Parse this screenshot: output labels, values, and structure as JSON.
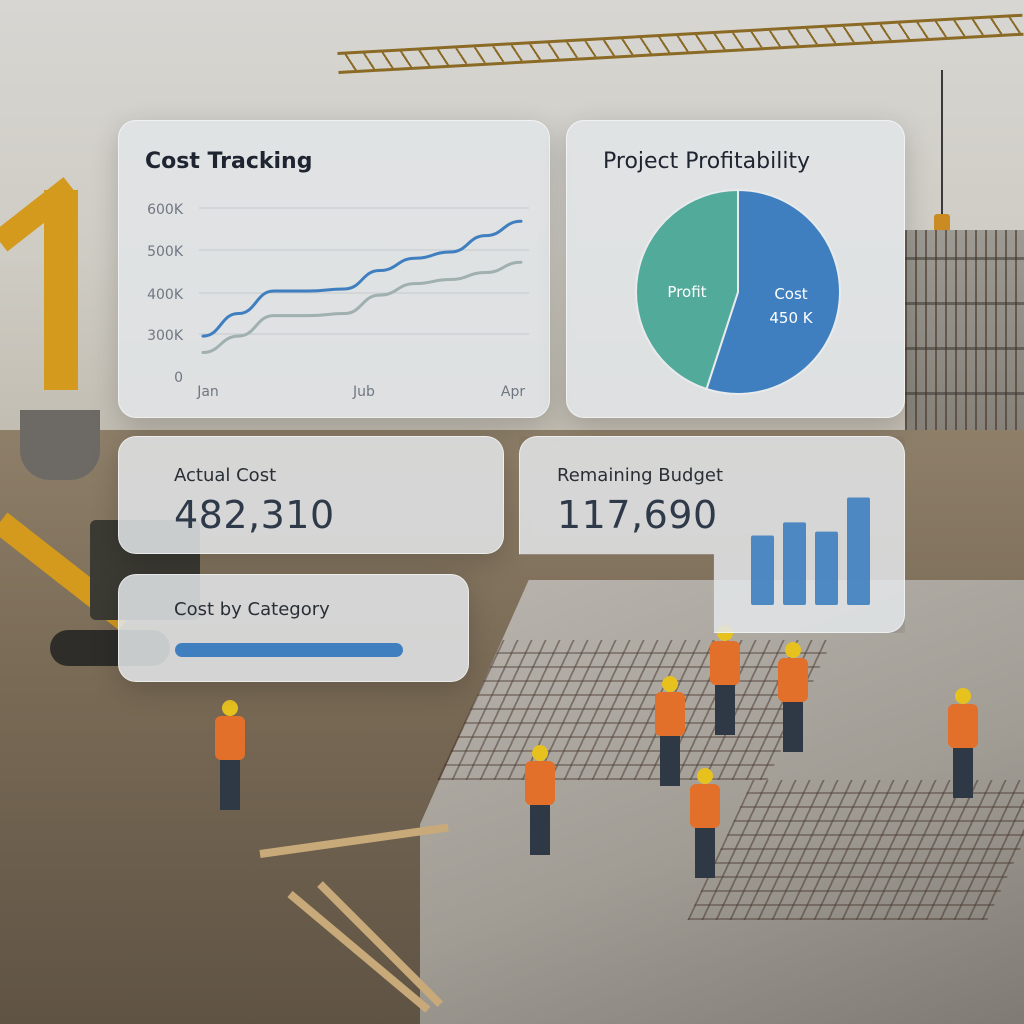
{
  "cost_tracking": {
    "title": "Cost Tracking"
  },
  "profitability": {
    "title": "Project Profitability"
  },
  "actual_cost": {
    "label": "Actual Cost",
    "value": "482,310"
  },
  "remaining_budget": {
    "label": "Remaining Budget",
    "value": "117,690"
  },
  "cost_by_category": {
    "label": "Cost by Category",
    "fill_fraction": 1.0
  },
  "colors": {
    "primary_blue": "#3f7fc0",
    "teal": "#52ab9a",
    "grey_line": "#9fb0ae",
    "card_bg": "#e2e5e8"
  },
  "chart_data": [
    {
      "type": "line",
      "title": "Cost Tracking",
      "x_tick_labels": [
        "Jan",
        "Jub",
        "Apr"
      ],
      "y_tick_labels": [
        "0",
        "300K",
        "400K",
        "500K",
        "600K"
      ],
      "ylim": [
        250000,
        650000
      ],
      "x": [
        0,
        1,
        2,
        3,
        4,
        5,
        6,
        7,
        8,
        9
      ],
      "series": [
        {
          "values": [
            340000,
            395000,
            450000,
            450000,
            455000,
            500000,
            530000,
            545000,
            585000,
            620000
          ],
          "color": "#3f7fc0"
        },
        {
          "values": [
            300000,
            340000,
            390000,
            390000,
            395000,
            440000,
            468000,
            478000,
            495000,
            520000
          ],
          "color": "#9fb0ae"
        }
      ],
      "grid": true,
      "legend": "none"
    },
    {
      "type": "pie",
      "title": "Project Profitability",
      "slices": [
        {
          "label": "Cost",
          "value_label": "450 K",
          "fraction": 0.55,
          "color": "#3f7fc0"
        },
        {
          "label": "Profit",
          "value_label": "",
          "fraction": 0.45,
          "color": "#52ab9a"
        }
      ]
    },
    {
      "type": "bar",
      "title": "",
      "categories": [
        "",
        "",
        "",
        ""
      ],
      "values": [
        5.3,
        6.3,
        5.6,
        8.2
      ],
      "ylim": [
        0,
        9
      ],
      "color": "#3f7fc0"
    }
  ]
}
